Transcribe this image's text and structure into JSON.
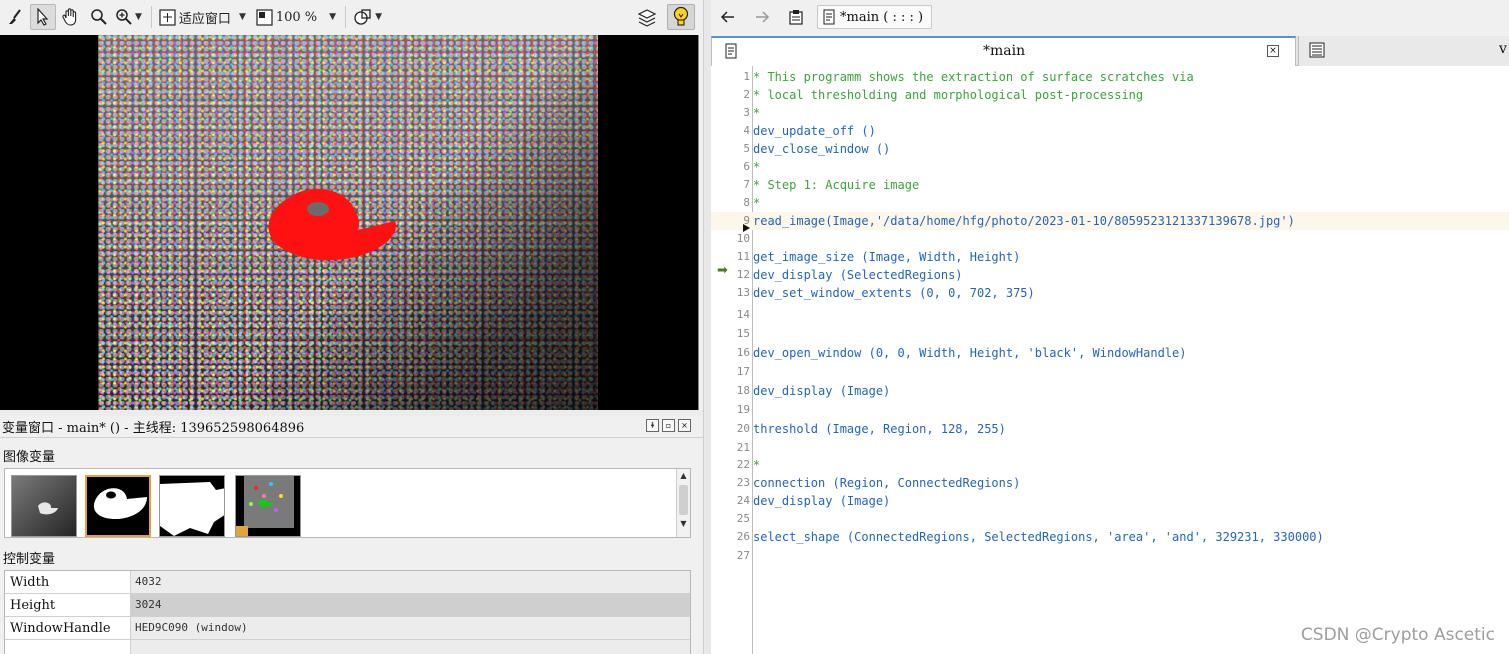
{
  "left_toolbar": {
    "fit_window_label": "适应窗口",
    "zoom_label": "100 %"
  },
  "variables_window": {
    "title": "变量窗口 - main* () - 主线程: 139652598064896",
    "image_vars_label": "图像变量",
    "control_vars_label": "控制变量",
    "control_vars": [
      {
        "name": "Width",
        "value": "4032"
      },
      {
        "name": "Height",
        "value": "3024"
      },
      {
        "name": "WindowHandle",
        "value": "HED9C090 (window)"
      }
    ]
  },
  "editor_toolbar": {
    "breadcrumb": "*main ( : : : )"
  },
  "tabs": {
    "active_label": "*main",
    "second_label": "v"
  },
  "code_lines": [
    {
      "n": "1",
      "text": "* This programm shows the extraction of surface scratches via",
      "kind": "comment"
    },
    {
      "n": "2",
      "text": "* local thresholding and morphological post-processing",
      "kind": "comment"
    },
    {
      "n": "3",
      "text": "*",
      "kind": "comment"
    },
    {
      "n": "4",
      "text": "dev_update_off ()",
      "kind": "op"
    },
    {
      "n": "5",
      "text": "dev_close_window ()",
      "kind": "op"
    },
    {
      "n": "6",
      "text": "*",
      "kind": "comment"
    },
    {
      "n": "7",
      "text": "* Step 1: Acquire image",
      "kind": "comment"
    },
    {
      "n": "8",
      "text": "*",
      "kind": "comment"
    },
    {
      "n": "9",
      "text": "read_image(Image,'/data/home/hfg/photo/2023-01-10/8059523121337139678.jpg')",
      "kind": "op"
    },
    {
      "n": "10",
      "text": "",
      "kind": "op"
    },
    {
      "n": "11",
      "text": "get_image_size (Image, Width, Height)",
      "kind": "op"
    },
    {
      "n": "12",
      "text": "dev_display (SelectedRegions)",
      "kind": "op"
    },
    {
      "n": "13",
      "text": "dev_set_window_extents (0, 0, 702, 375)",
      "kind": "op"
    },
    {
      "n": "14",
      "text": "",
      "kind": "op"
    },
    {
      "n": "15",
      "text": "",
      "kind": "op"
    },
    {
      "n": "16",
      "text": "dev_open_window (0, 0, Width, Height, 'black', WindowHandle)",
      "kind": "op"
    },
    {
      "n": "17",
      "text": "",
      "kind": "op"
    },
    {
      "n": "18",
      "text": "dev_display (Image)",
      "kind": "op"
    },
    {
      "n": "19",
      "text": "",
      "kind": "op"
    },
    {
      "n": "20",
      "text": "threshold (Image, Region, 128, 255)",
      "kind": "op"
    },
    {
      "n": "21",
      "text": "",
      "kind": "op"
    },
    {
      "n": "22",
      "text": "*",
      "kind": "comment"
    },
    {
      "n": "23",
      "text": "connection (Region, ConnectedRegions)",
      "kind": "op"
    },
    {
      "n": "24",
      "text": "dev_display (Image)",
      "kind": "op"
    },
    {
      "n": "25",
      "text": "",
      "kind": "op"
    },
    {
      "n": "26",
      "text": "select_shape (ConnectedRegions, SelectedRegions, 'area', 'and', 329231, 330000)",
      "kind": "op"
    },
    {
      "n": "27",
      "text": "",
      "kind": "op"
    }
  ],
  "watermark": "CSDN @Crypto Ascetic"
}
